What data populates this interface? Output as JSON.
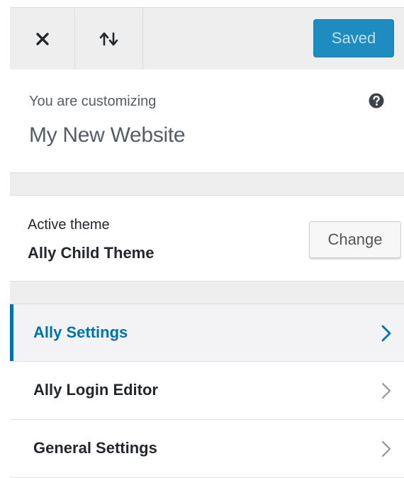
{
  "toolbar": {
    "close_icon": "close-icon",
    "sort_icon": "reorder-arrows-icon",
    "saved_label": "Saved",
    "accent_color": "#1e8cbe"
  },
  "customizing": {
    "label": "You are customizing",
    "site_title": "My New Website",
    "help_icon": "help-icon"
  },
  "theme": {
    "label": "Active theme",
    "name": "Ally Child Theme",
    "change_label": "Change"
  },
  "sections": [
    {
      "label": "Ally Settings",
      "active": true
    },
    {
      "label": "Ally Login Editor",
      "active": false
    },
    {
      "label": "General Settings",
      "active": false
    }
  ],
  "colors": {
    "active_text": "#0073aa",
    "text": "#23282d",
    "muted": "#555d66",
    "background_band": "#eeeeee"
  }
}
